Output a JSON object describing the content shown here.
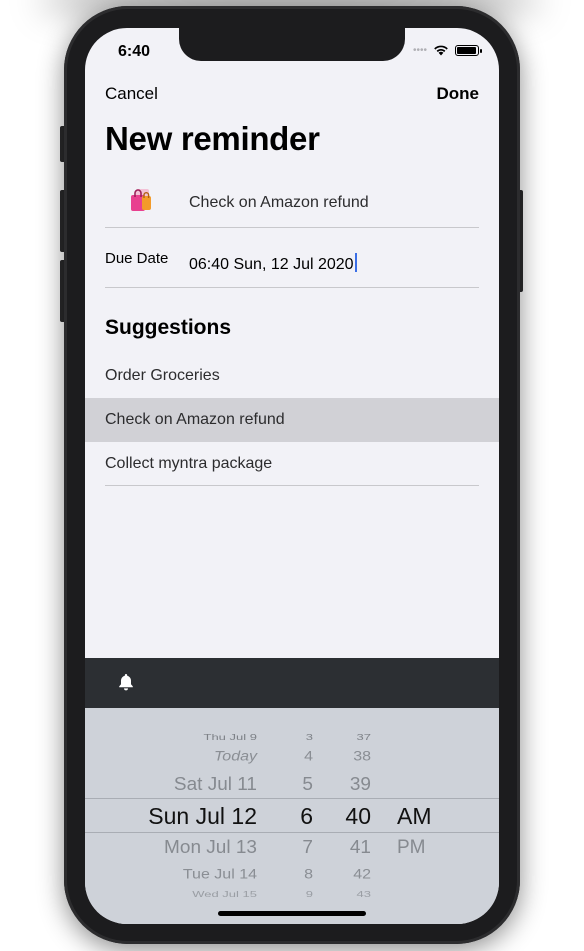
{
  "status_bar": {
    "time": "6:40",
    "signal_dots": "••••"
  },
  "nav": {
    "cancel_label": "Cancel",
    "done_label": "Done"
  },
  "page_title": "New reminder",
  "reminder": {
    "icon": "shopping-bag-icon",
    "title": "Check on Amazon refund",
    "due_label": "Due Date",
    "due_value": "06:40 Sun, 12 Jul 2020"
  },
  "suggestions": {
    "heading": "Suggestions",
    "items": [
      {
        "label": "Order Groceries",
        "selected": false
      },
      {
        "label": "Check on Amazon refund",
        "selected": true
      },
      {
        "label": "Collect myntra package",
        "selected": false
      }
    ]
  },
  "toolbar": {
    "icon": "bell-icon"
  },
  "picker": {
    "dates": [
      "Thu Jul 9",
      "Today",
      "Sat Jul 11",
      "Sun Jul 12",
      "Mon Jul 13",
      "Tue Jul 14",
      "Wed Jul 15"
    ],
    "hours": [
      "3",
      "4",
      "5",
      "6",
      "7",
      "8",
      "9"
    ],
    "minutes": [
      "37",
      "38",
      "39",
      "40",
      "41",
      "42",
      "43"
    ],
    "periods": [
      "AM",
      "PM"
    ],
    "selected": {
      "date": "Sun Jul 12",
      "hour": "6",
      "minute": "40",
      "period": "AM"
    }
  },
  "colors": {
    "background": "#f2f2f7",
    "selected_row": "#d1d1d6",
    "toolbar": "#2c2f33",
    "picker": "#ced2d9",
    "caret": "#3b6fe6"
  }
}
